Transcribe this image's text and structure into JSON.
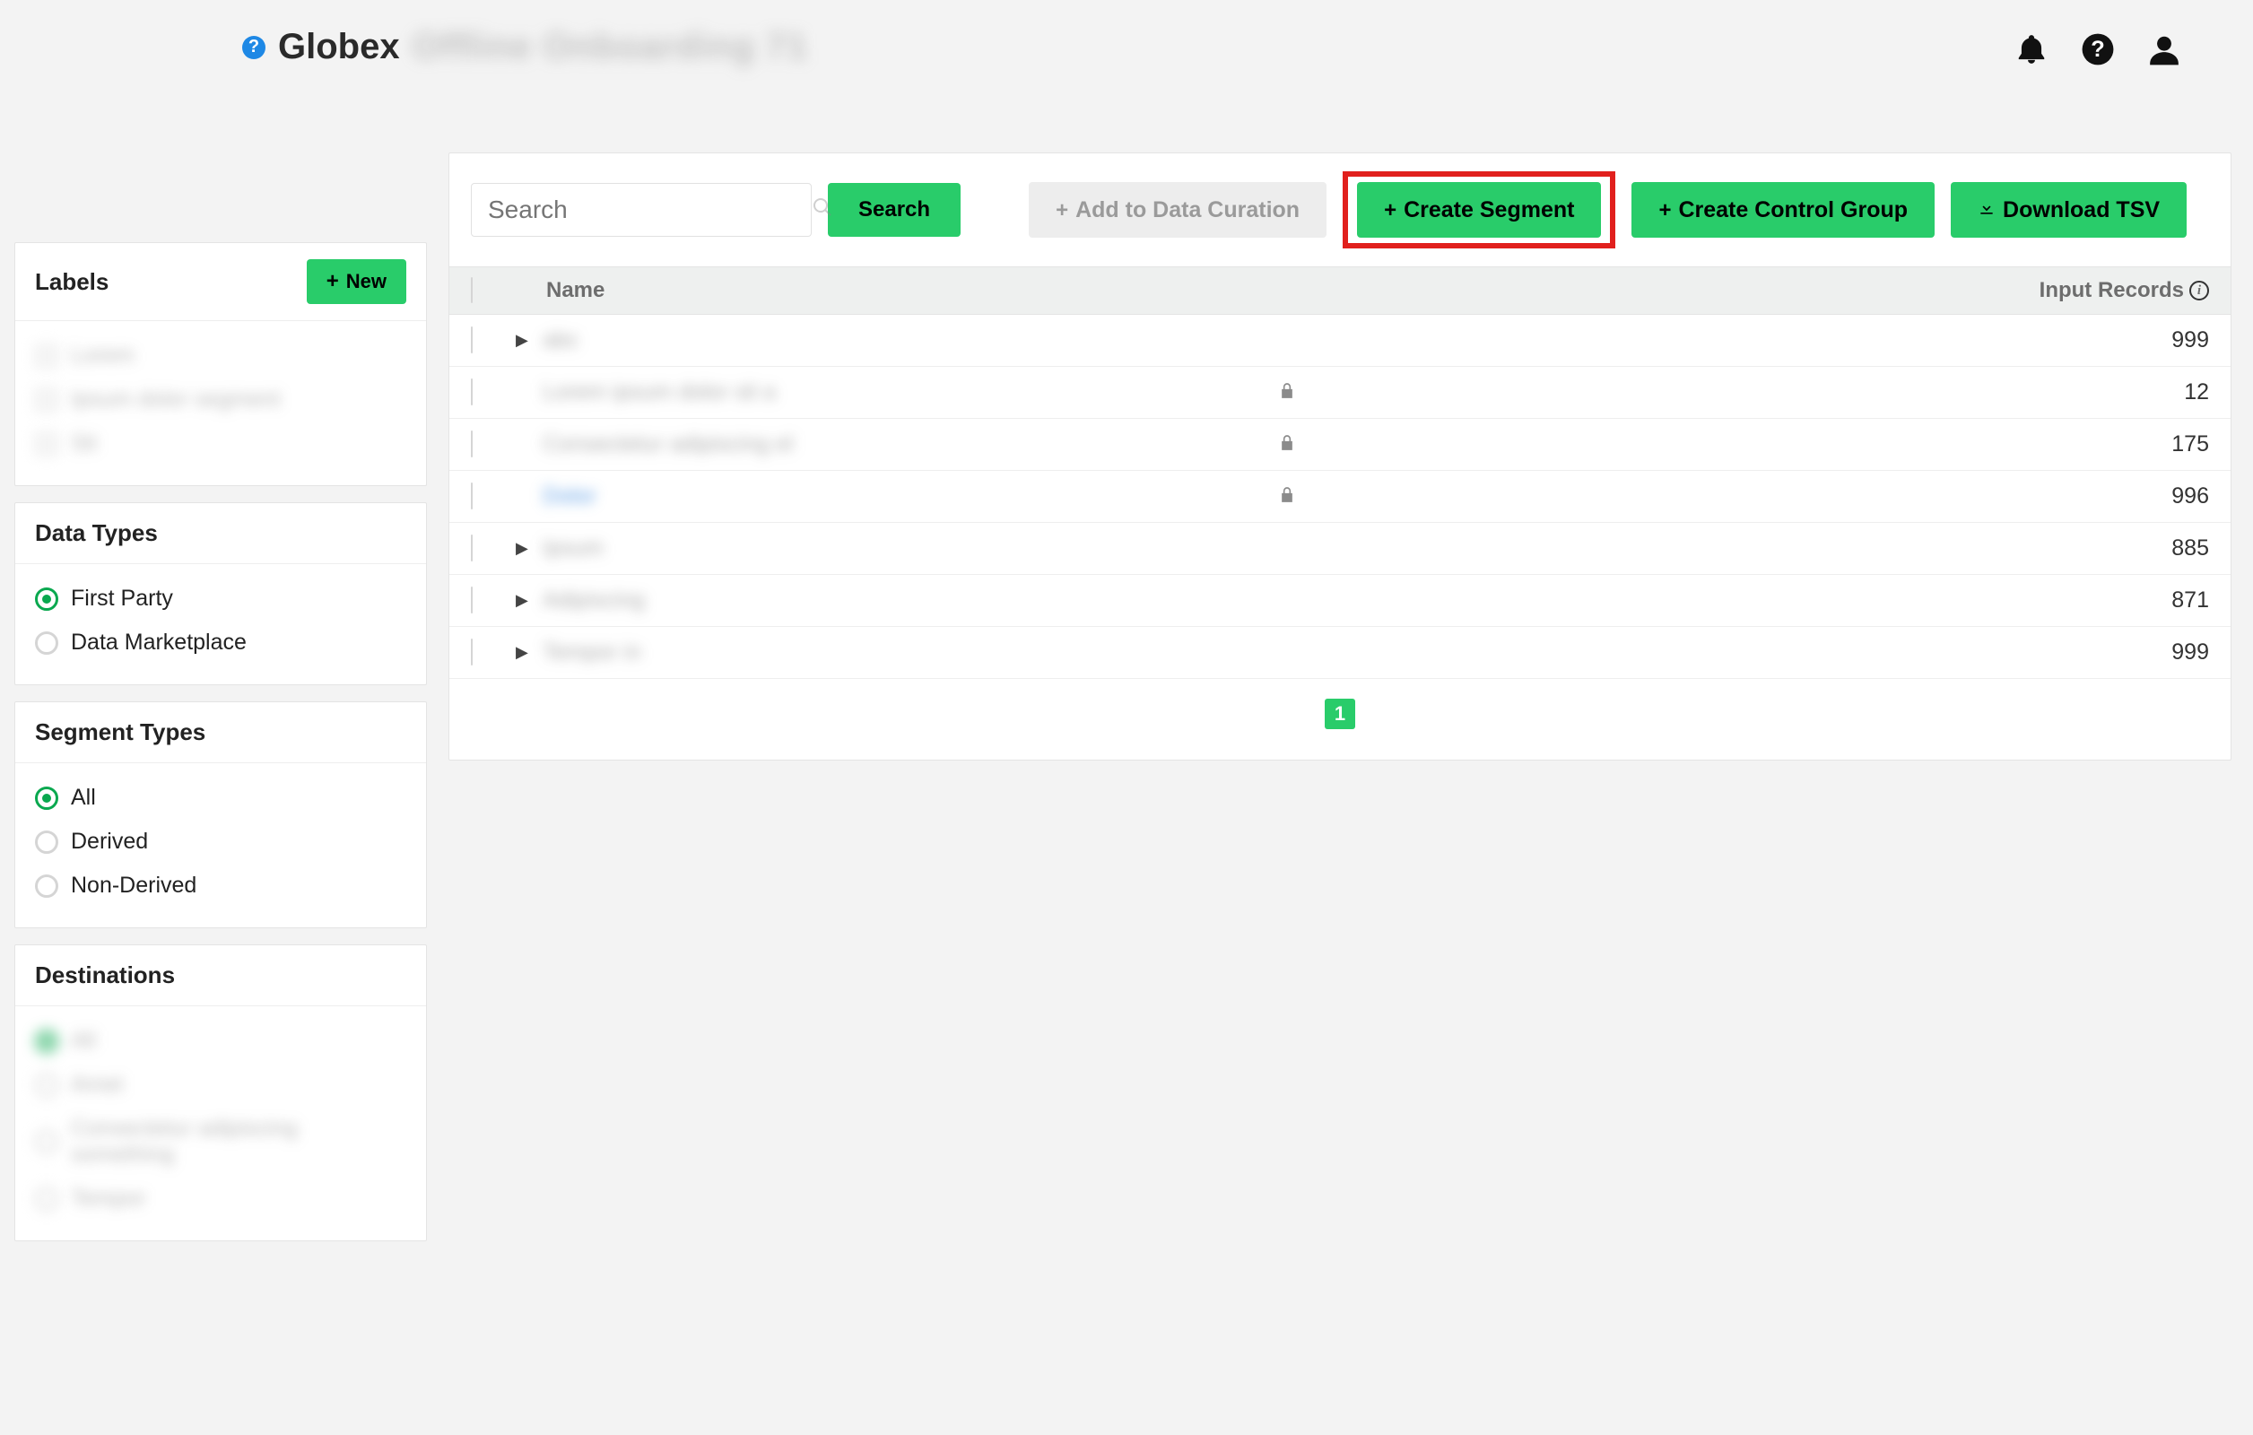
{
  "header": {
    "brand": "Globex",
    "breadcrumb_blur": "Offline Onboarding   71"
  },
  "toolbar": {
    "search_placeholder": "Search",
    "search_button": "Search",
    "add_curation": "Add to Data Curation",
    "create_segment": "Create Segment",
    "create_control_group": "Create Control Group",
    "download_tsv": "Download TSV"
  },
  "sidebar": {
    "labels": {
      "title": "Labels",
      "new_button": "New",
      "items": [
        {
          "label": "Lorem"
        },
        {
          "label": "Ipsum dolor segment"
        },
        {
          "label": "Sit"
        }
      ]
    },
    "data_types": {
      "title": "Data Types",
      "items": [
        {
          "label": "First Party",
          "selected": true
        },
        {
          "label": "Data Marketplace",
          "selected": false
        }
      ]
    },
    "segment_types": {
      "title": "Segment Types",
      "items": [
        {
          "label": "All",
          "selected": true
        },
        {
          "label": "Derived",
          "selected": false
        },
        {
          "label": "Non-Derived",
          "selected": false
        }
      ]
    },
    "destinations": {
      "title": "Destinations",
      "items": [
        {
          "label": "All",
          "selected": true
        },
        {
          "label": "Amet",
          "selected": false
        },
        {
          "label": "Consectetur adipiscing something",
          "selected": false
        },
        {
          "label": "Tempor",
          "selected": false
        }
      ]
    }
  },
  "table": {
    "columns": {
      "name": "Name",
      "records": "Input Records"
    },
    "rows": [
      {
        "name": "abc",
        "records": 999,
        "expandable": true,
        "locked": false,
        "link": false
      },
      {
        "name": "Lorem ipsum dolor sit a",
        "records": 12,
        "expandable": false,
        "locked": true,
        "link": false
      },
      {
        "name": "Consectetur adipiscing el",
        "records": 175,
        "expandable": false,
        "locked": true,
        "link": false
      },
      {
        "name": "Dolor",
        "records": 996,
        "expandable": false,
        "locked": true,
        "link": true
      },
      {
        "name": "Ipsum",
        "records": 885,
        "expandable": true,
        "locked": false,
        "link": false
      },
      {
        "name": "Adipiscing",
        "records": 871,
        "expandable": true,
        "locked": false,
        "link": false
      },
      {
        "name": "Tempor in",
        "records": 999,
        "expandable": true,
        "locked": false,
        "link": false
      }
    ]
  },
  "pagination": {
    "current": "1"
  }
}
